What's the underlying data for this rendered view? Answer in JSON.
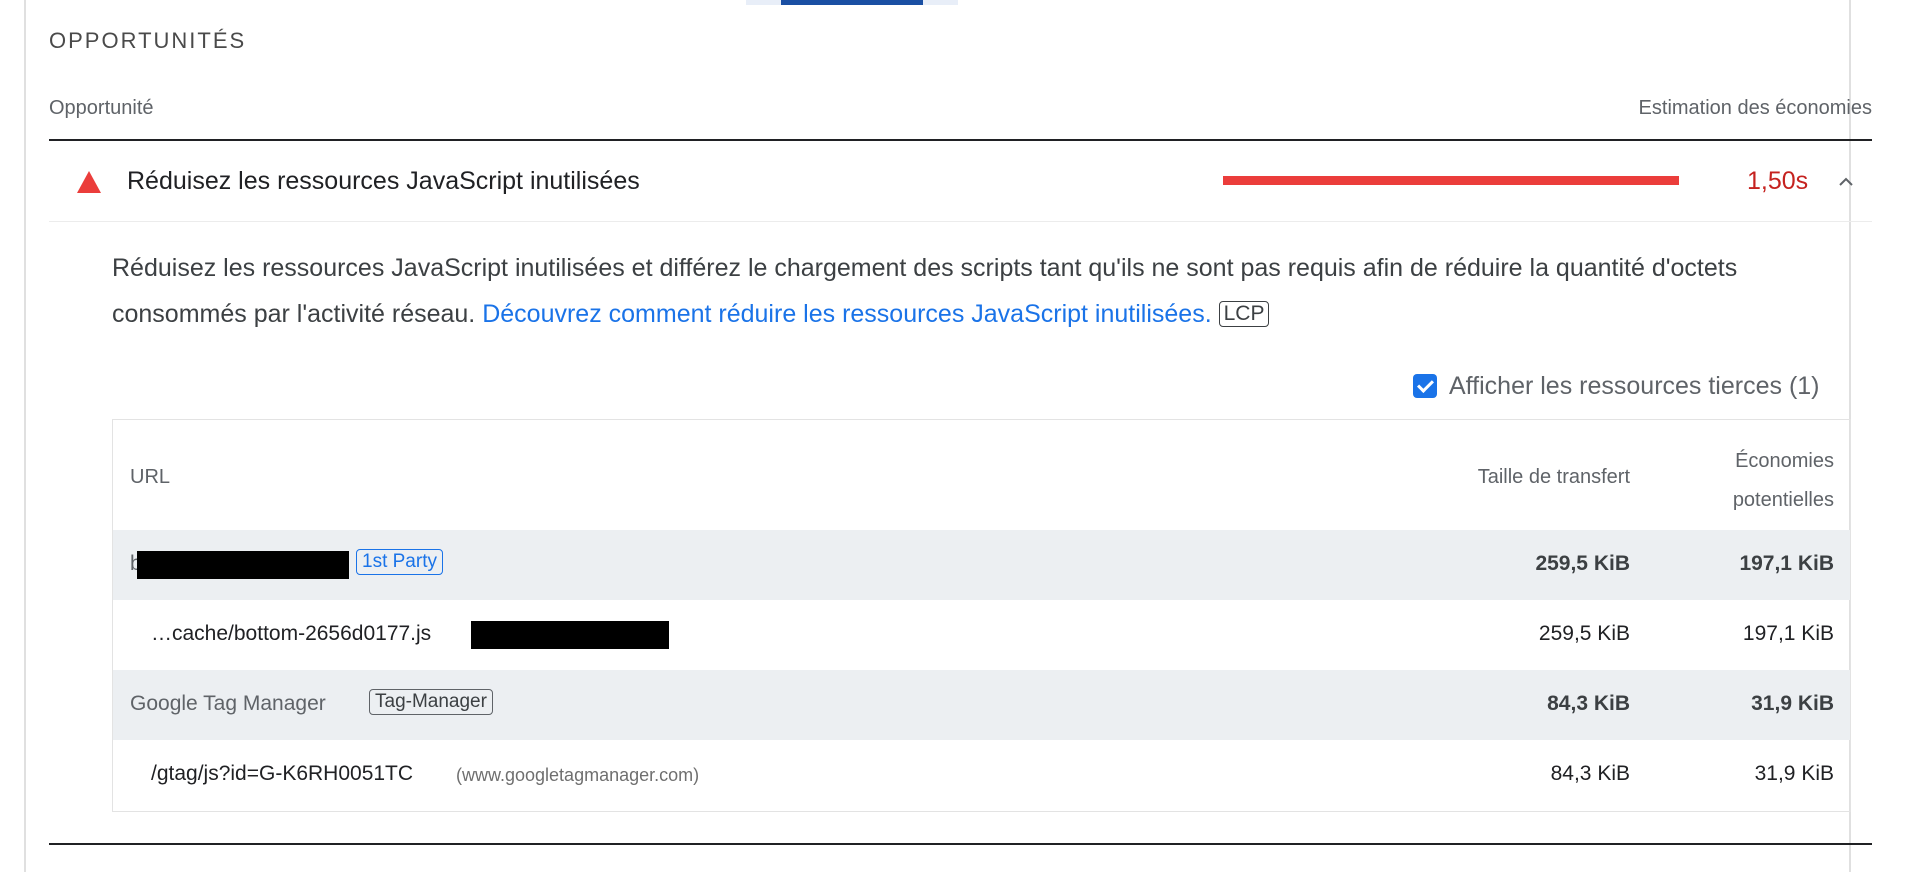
{
  "section": {
    "title": "OPPORTUNITÉS"
  },
  "header": {
    "left": "Opportunité",
    "right": "Estimation des économies"
  },
  "audit": {
    "title": "Réduisez les ressources JavaScript inutilisées",
    "savings": "1,50s",
    "status_color": "#eb3d3b",
    "description_prefix": "Réduisez les ressources JavaScript inutilisées et différez le chargement des scripts tant qu'ils ne sont pas requis afin de réduire la quantité d'octets consommés par l'activité réseau. ",
    "link_text": "Découvrez comment réduire les ressources JavaScript inutilisées.",
    "tag": "LCP"
  },
  "third_party_toggle": {
    "label": "Afficher les ressources tierces (1)",
    "checked": true
  },
  "table": {
    "columns": {
      "url": "URL",
      "transfer_size": "Taille de transfert",
      "savings_line1": "Économies",
      "savings_line2": "potentielles"
    },
    "rows": [
      {
        "kind": "group",
        "entity": "b",
        "badge": "1st Party",
        "size": "259,5 KiB",
        "savings": "197,1 KiB"
      },
      {
        "kind": "item",
        "url": "…cache/bottom-2656d0177.js",
        "size": "259,5 KiB",
        "savings": "197,1 KiB"
      },
      {
        "kind": "group",
        "entity": "Google Tag Manager",
        "badge": "Tag-Manager",
        "size": "84,3 KiB",
        "savings": "31,9 KiB"
      },
      {
        "kind": "item",
        "url": "/gtag/js?id=G-K6RH0051TC",
        "host": "(www.googletagmanager.com)",
        "size": "84,3 KiB",
        "savings": "31,9 KiB"
      }
    ]
  },
  "colors": {
    "accent": "#1a73e8",
    "fail": "#eb3d3b",
    "savings_text": "#c5221f"
  }
}
